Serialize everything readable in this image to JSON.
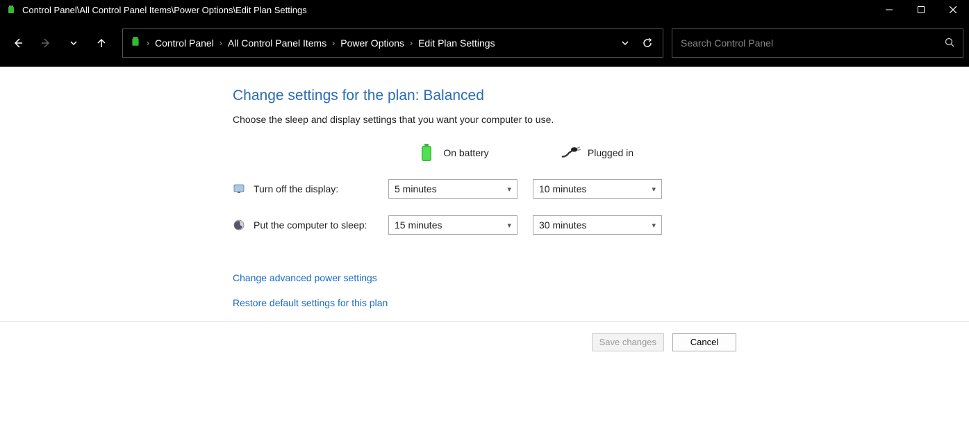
{
  "window": {
    "title": "Control Panel\\All Control Panel Items\\Power Options\\Edit Plan Settings"
  },
  "breadcrumbs": {
    "items": [
      "Control Panel",
      "All Control Panel Items",
      "Power Options",
      "Edit Plan Settings"
    ]
  },
  "search": {
    "placeholder": "Search Control Panel"
  },
  "main": {
    "heading": "Change settings for the plan: Balanced",
    "subheading": "Choose the sleep and display settings that you want your computer to use.",
    "column_headers": {
      "battery": "On battery",
      "plugged": "Plugged in"
    },
    "rows": [
      {
        "label": "Turn off the display:",
        "battery": "5 minutes",
        "plugged": "10 minutes"
      },
      {
        "label": "Put the computer to sleep:",
        "battery": "15 minutes",
        "plugged": "30 minutes"
      }
    ],
    "links": {
      "advanced": "Change advanced power settings",
      "restore": "Restore default settings for this plan"
    }
  },
  "buttons": {
    "save": "Save changes",
    "cancel": "Cancel"
  }
}
